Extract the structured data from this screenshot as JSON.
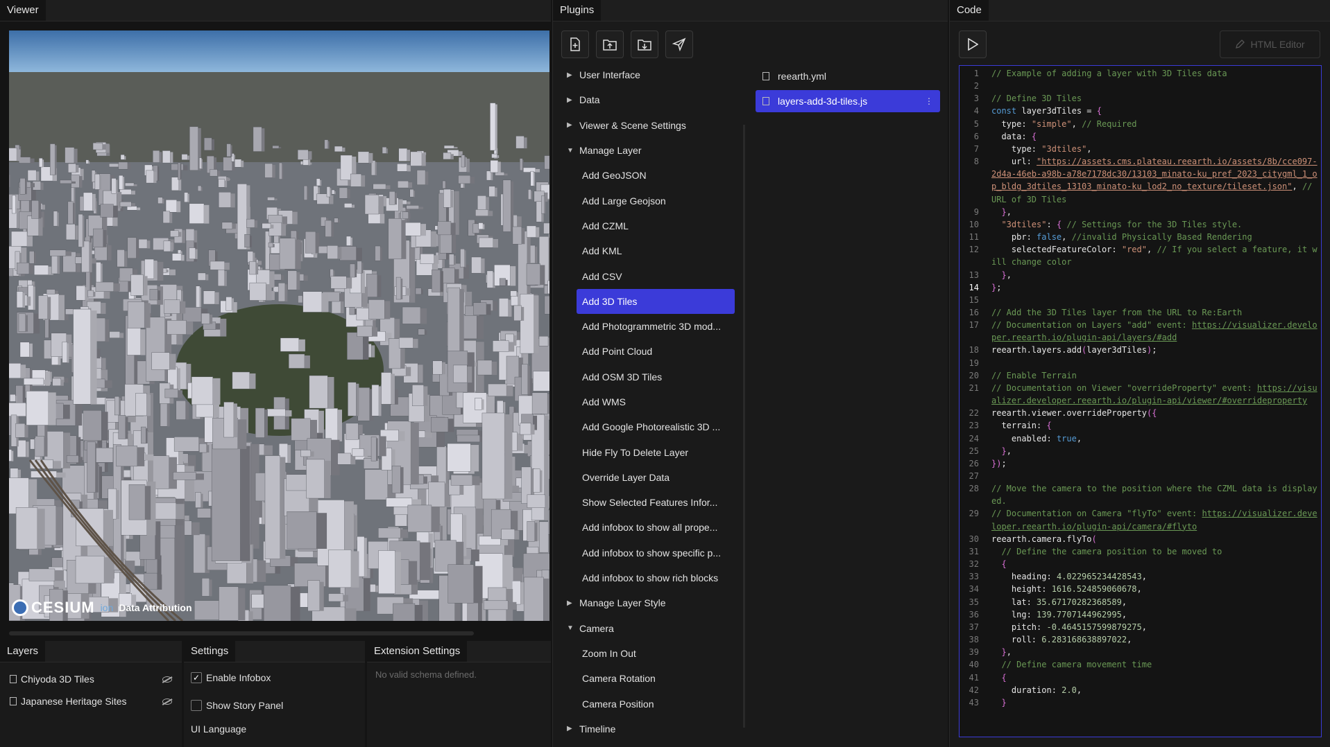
{
  "viewer": {
    "tab": "Viewer",
    "attribution": {
      "logo": "CESIUM",
      "ion": "ion",
      "data_attribution": "Data Attribution"
    }
  },
  "layers": {
    "tab": "Layers",
    "items": [
      {
        "label": "Chiyoda 3D Tiles"
      },
      {
        "label": "Japanese Heritage Sites"
      }
    ]
  },
  "settings": {
    "tab": "Settings",
    "enable_infobox": "Enable Infobox",
    "show_story_panel": "Show Story Panel",
    "ui_language": "UI Language"
  },
  "extension": {
    "tab": "Extension Settings",
    "empty": "No valid schema defined."
  },
  "plugins": {
    "tab": "Plugins",
    "tree": [
      {
        "label": "User Interface",
        "type": "group",
        "open": false
      },
      {
        "label": "Data",
        "type": "group",
        "open": false
      },
      {
        "label": "Viewer & Scene Settings",
        "type": "group",
        "open": false
      },
      {
        "label": "Manage Layer",
        "type": "group",
        "open": true
      },
      {
        "label": "Add GeoJSON",
        "type": "child"
      },
      {
        "label": "Add Large Geojson",
        "type": "child"
      },
      {
        "label": "Add CZML",
        "type": "child"
      },
      {
        "label": "Add KML",
        "type": "child"
      },
      {
        "label": "Add CSV",
        "type": "child"
      },
      {
        "label": "Add 3D Tiles",
        "type": "child",
        "selected": true
      },
      {
        "label": "Add Photogrammetric 3D mod...",
        "type": "child"
      },
      {
        "label": "Add Point Cloud",
        "type": "child"
      },
      {
        "label": "Add OSM 3D Tiles",
        "type": "child"
      },
      {
        "label": "Add WMS",
        "type": "child"
      },
      {
        "label": "Add Google Photorealistic 3D ...",
        "type": "child"
      },
      {
        "label": "Hide Fly To Delete Layer",
        "type": "child"
      },
      {
        "label": "Override Layer Data",
        "type": "child"
      },
      {
        "label": "Show Selected Features Infor...",
        "type": "child"
      },
      {
        "label": "Add infobox to show all prope...",
        "type": "child"
      },
      {
        "label": "Add infobox to show specific p...",
        "type": "child"
      },
      {
        "label": "Add infobox to show rich blocks",
        "type": "child"
      },
      {
        "label": "Manage Layer Style",
        "type": "group",
        "open": false
      },
      {
        "label": "Camera",
        "type": "group",
        "open": true
      },
      {
        "label": "Zoom In Out",
        "type": "child"
      },
      {
        "label": "Camera Rotation",
        "type": "child"
      },
      {
        "label": "Camera Position",
        "type": "child"
      },
      {
        "label": "Timeline",
        "type": "group",
        "open": false
      }
    ],
    "files": [
      {
        "name": "reearth.yml",
        "selected": false
      },
      {
        "name": "layers-add-3d-tiles.js",
        "selected": true
      }
    ]
  },
  "code": {
    "tab": "Code",
    "html_editor": "HTML Editor",
    "active_line": 14,
    "lines": [
      {
        "n": "1",
        "t": "// Example of adding a layer with 3D Tiles data",
        "k": "com"
      },
      {
        "n": "2",
        "t": ""
      },
      {
        "n": "3",
        "t": "// Define 3D Tiles",
        "k": "com"
      },
      {
        "n": "4",
        "t": "const layer3dTiles = {"
      },
      {
        "n": "5",
        "t": "  type: \"simple\", // Required"
      },
      {
        "n": "6",
        "t": "  data: {"
      },
      {
        "n": "7",
        "t": "    type: \"3dtiles\","
      },
      {
        "n": "8",
        "t": "    url: \"https://assets.cms.plateau.reearth.io/assets/8b/cce097-2d4a-46eb-a98b-a78e7178dc30/13103_minato-ku_pref_2023_citygml_1_op_bldg_3dtiles_13103_minato-ku_lod2_no_texture/tileset.json\", // URL of 3D Tiles"
      },
      {
        "n": "9",
        "t": "  },"
      },
      {
        "n": "10",
        "t": "  \"3dtiles\": { // Settings for the 3D Tiles style."
      },
      {
        "n": "11",
        "t": "    pbr: false, //invalid Physically Based Rendering"
      },
      {
        "n": "12",
        "t": "    selectedFeatureColor: \"red\", // If you select a feature, it will change color"
      },
      {
        "n": "13",
        "t": "  },"
      },
      {
        "n": "14",
        "t": "};"
      },
      {
        "n": "15",
        "t": ""
      },
      {
        "n": "16",
        "t": "// Add the 3D Tiles layer from the URL to Re:Earth",
        "k": "com"
      },
      {
        "n": "17",
        "t": "// Documentation on Layers \"add\" event: https://visualizer.developer.reearth.io/plugin-api/layers/#add",
        "k": "com"
      },
      {
        "n": "18",
        "t": "reearth.layers.add(layer3dTiles);"
      },
      {
        "n": "19",
        "t": ""
      },
      {
        "n": "20",
        "t": "// Enable Terrain",
        "k": "com"
      },
      {
        "n": "21",
        "t": "// Documentation on Viewer \"overrideProperty\" event: https://visualizer.developer.reearth.io/plugin-api/viewer/#overrideproperty",
        "k": "com"
      },
      {
        "n": "22",
        "t": "reearth.viewer.overrideProperty({"
      },
      {
        "n": "23",
        "t": "  terrain: {"
      },
      {
        "n": "24",
        "t": "    enabled: true,"
      },
      {
        "n": "25",
        "t": "  },"
      },
      {
        "n": "26",
        "t": "});"
      },
      {
        "n": "27",
        "t": ""
      },
      {
        "n": "28",
        "t": "// Move the camera to the position where the CZML data is displayed.",
        "k": "com"
      },
      {
        "n": "29",
        "t": "// Documentation on Camera \"flyTo\" event: https://visualizer.developer.reearth.io/plugin-api/camera/#flyto",
        "k": "com"
      },
      {
        "n": "30",
        "t": "reearth.camera.flyTo("
      },
      {
        "n": "31",
        "t": "  // Define the camera position to be moved to",
        "k": "com"
      },
      {
        "n": "32",
        "t": "  {"
      },
      {
        "n": "33",
        "t": "    heading: 4.022965234428543,"
      },
      {
        "n": "34",
        "t": "    height: 1616.524859060678,"
      },
      {
        "n": "35",
        "t": "    lat: 35.67170282368589,"
      },
      {
        "n": "36",
        "t": "    lng: 139.7707144962995,"
      },
      {
        "n": "37",
        "t": "    pitch: -0.4645157599879275,"
      },
      {
        "n": "38",
        "t": "    roll: 6.283168638897022,"
      },
      {
        "n": "39",
        "t": "  },"
      },
      {
        "n": "40",
        "t": "  // Define camera movement time",
        "k": "com"
      },
      {
        "n": "41",
        "t": "  {"
      },
      {
        "n": "42",
        "t": "    duration: 2.0,"
      },
      {
        "n": "43",
        "t": "  }"
      }
    ]
  }
}
